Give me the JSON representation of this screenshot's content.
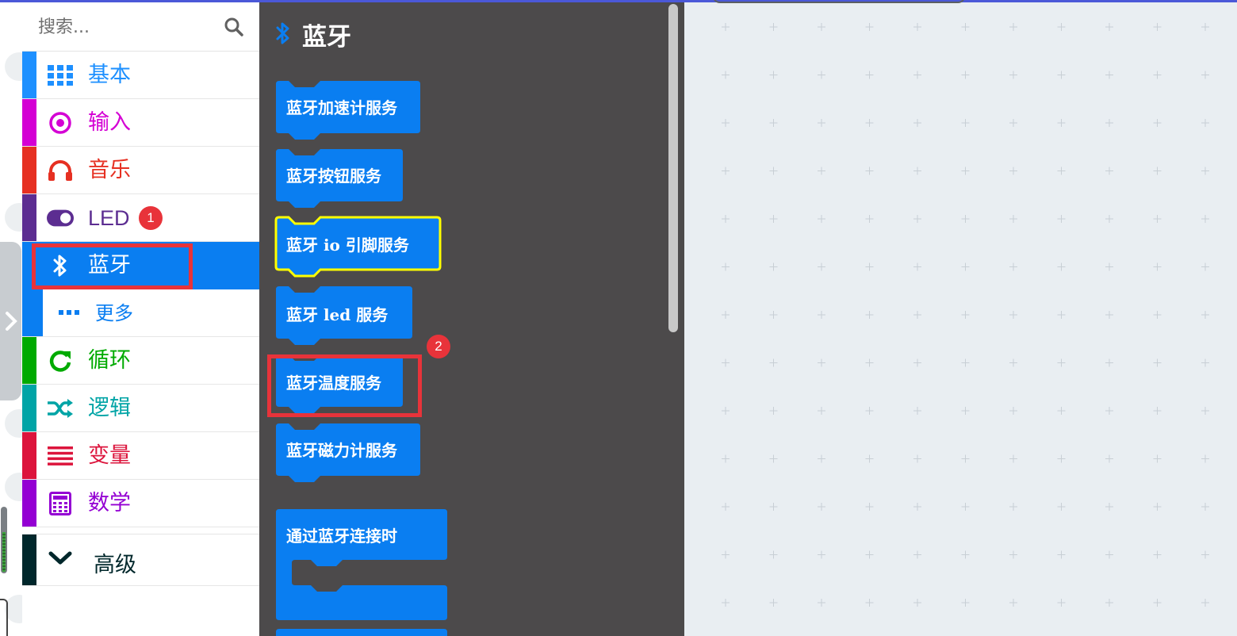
{
  "search": {
    "placeholder": "搜索..."
  },
  "colors": {
    "basic": "#1e90ff",
    "input": "#d400d4",
    "music": "#e63022",
    "led": "#5c2d91",
    "bluetooth": "#0a7ef1",
    "loops": "#00aa00",
    "logic": "#00a4a6",
    "variables": "#dc143c",
    "math": "#9400d3",
    "advanced": "#00272b",
    "flyout_bg": "#4c4a4b",
    "block": "#0a7ef1",
    "highlight": "#ffff00",
    "annotation": "#e8333a",
    "workspace_bg": "#e9eef2"
  },
  "categories": [
    {
      "id": "basic",
      "label": "基本",
      "icon": "grid-icon"
    },
    {
      "id": "input",
      "label": "输入",
      "icon": "target-icon"
    },
    {
      "id": "music",
      "label": "音乐",
      "icon": "headphones-icon"
    },
    {
      "id": "led",
      "label": "LED",
      "icon": "toggle-icon",
      "badge": "1"
    },
    {
      "id": "bluetooth",
      "label": "蓝牙",
      "icon": "bluetooth-icon",
      "selected": true
    },
    {
      "id": "more",
      "label": "更多",
      "icon": "ellipsis-icon"
    },
    {
      "id": "loops",
      "label": "循环",
      "icon": "refresh-icon"
    },
    {
      "id": "logic",
      "label": "逻辑",
      "icon": "shuffle-icon"
    },
    {
      "id": "variables",
      "label": "变量",
      "icon": "lines-icon"
    },
    {
      "id": "math",
      "label": "数学",
      "icon": "calculator-icon"
    }
  ],
  "advanced": {
    "label": "高级",
    "icon": "chevron-down-icon"
  },
  "flyout": {
    "title": "蓝牙",
    "blocks": [
      {
        "label": "蓝牙加速计服务"
      },
      {
        "label": "蓝牙按钮服务"
      },
      {
        "label": "蓝牙 io 引脚服务",
        "highlighted": true
      },
      {
        "label": "蓝牙 led 服务"
      },
      {
        "label": "蓝牙温度服务",
        "badge": "2"
      },
      {
        "label": "蓝牙磁力计服务"
      },
      {
        "label": "通过蓝牙连接时"
      }
    ]
  }
}
